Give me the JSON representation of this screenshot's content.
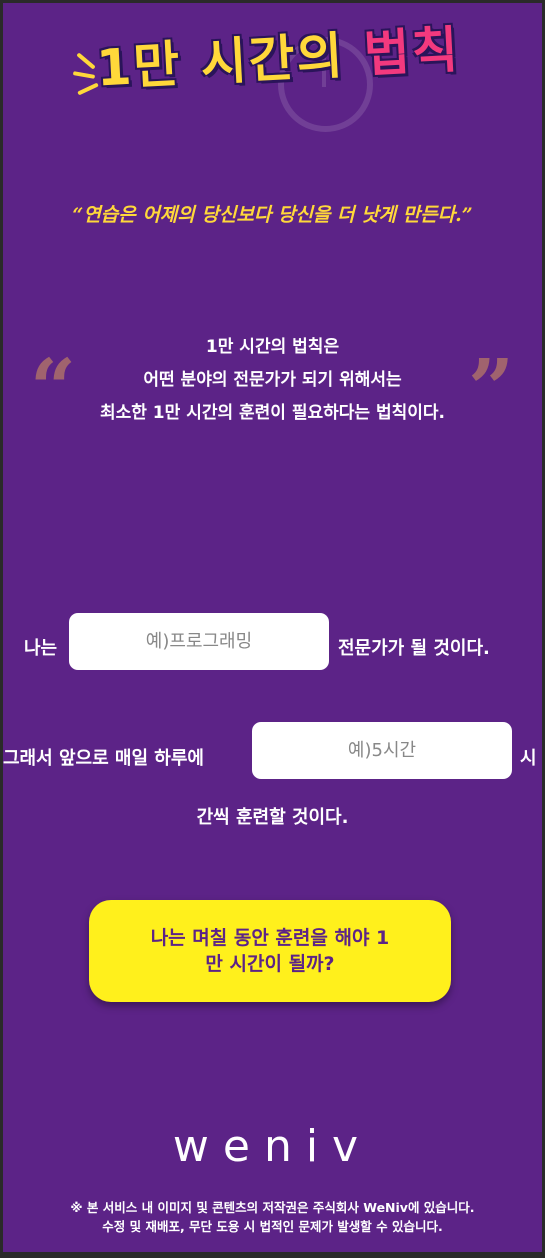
{
  "header": {
    "title_main": "1만 시간의 ",
    "title_accent": "법칙",
    "quote": "“연습은 어제의 당신보다 당신을 더 낫게 만든다.”"
  },
  "description": {
    "highlight": "1만 시간의 법칙",
    "line1_suffix": "은",
    "line2": "어떤 분야의 전문가가 되기 위해서는",
    "line3": "최소한 1만 시간의 훈련이 필요하다는 법칙이다.",
    "open_quote_mark": "“",
    "close_quote_mark": "”"
  },
  "form": {
    "prefix1": "나는",
    "field_name_placeholder": "예)프로그래밍",
    "suffix1": "전문가가 될 것이다.",
    "prefix2": "그래서 앞으로 매일 하루에",
    "field_hours_placeholder": "예)5시간",
    "suffix2a": "시",
    "suffix2b": "간씩 훈련할 것이다."
  },
  "cta": {
    "label": "나는 며칠 동안 훈련을 해야 1만 시간이 될까?"
  },
  "brand": {
    "logo_text": "weniv"
  },
  "footer": {
    "line1": "※ 본 서비스 내 이미지 및 콘텐츠의 저작권은 주식회사 WeNiv에 있습니다.",
    "line2": "수정 및 재배포, 무단 도용 시 법적인 문제가 발생할 수 있습니다."
  },
  "colors": {
    "background": "#5c2387",
    "accent_yellow": "#ffd83a",
    "button_yellow": "#fff01c",
    "pink": "#f2397e"
  }
}
